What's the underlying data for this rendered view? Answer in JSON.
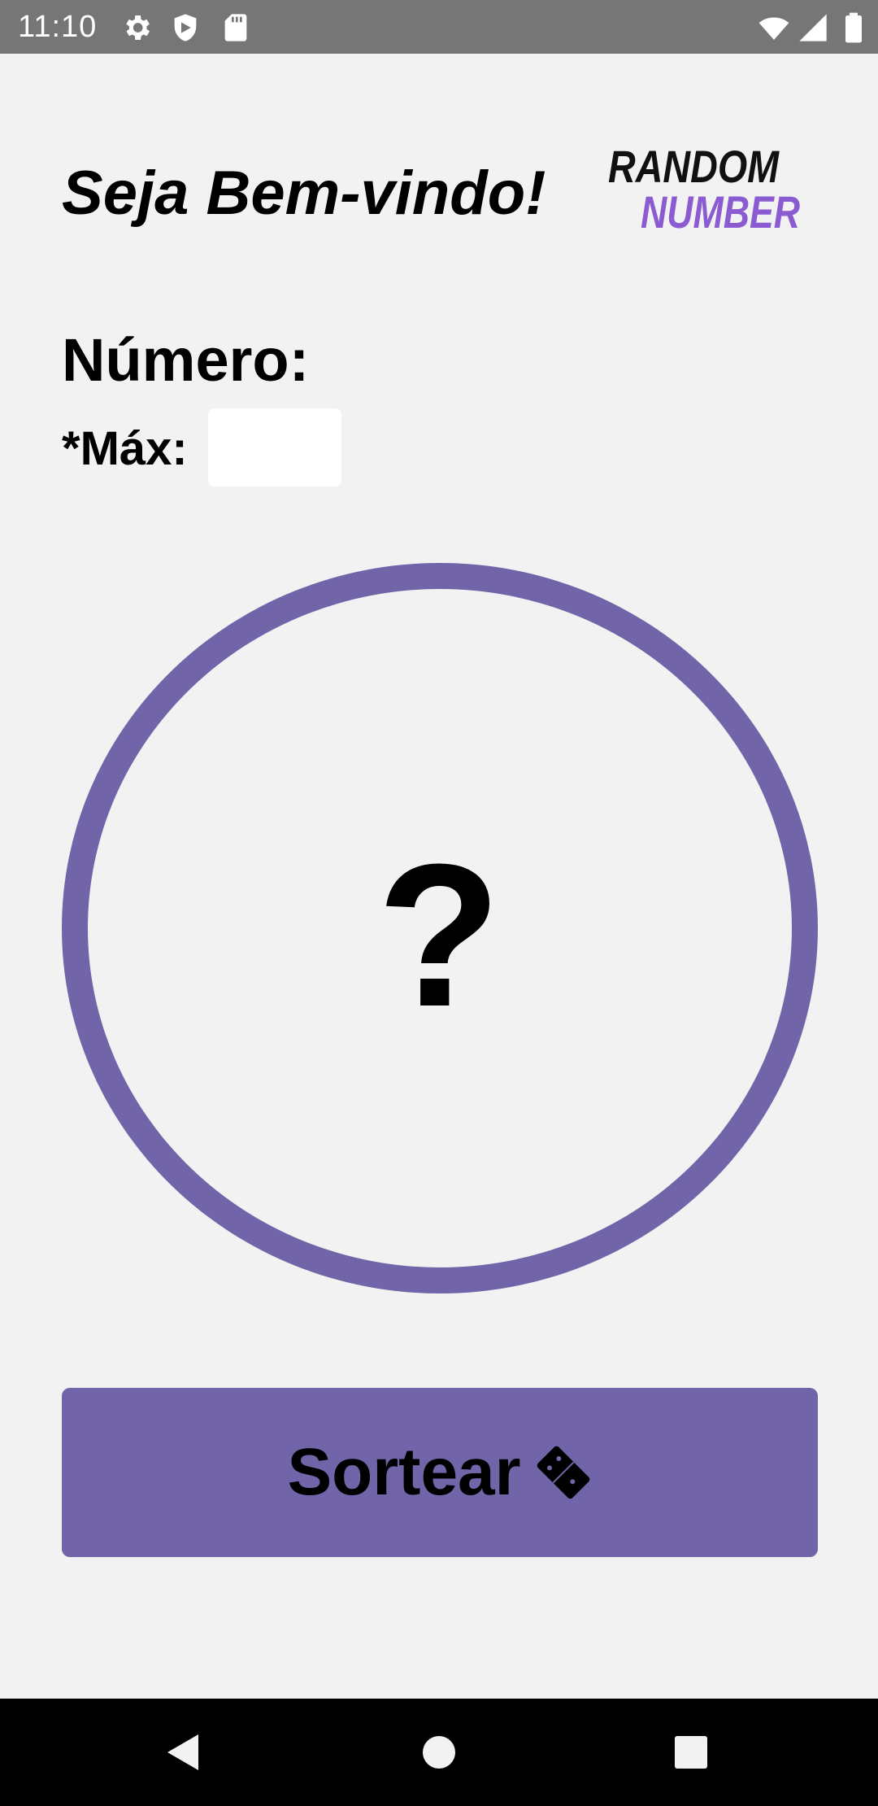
{
  "status_bar": {
    "time": "11:10",
    "icons": [
      "gear-icon",
      "shield-icon",
      "sd-card-icon",
      "wifi-icon",
      "signal-icon",
      "battery-icon"
    ]
  },
  "header": {
    "welcome": "Seja Bem-vindo!",
    "logo_line1": "RANDOM",
    "logo_line2": "NUMBER"
  },
  "form": {
    "number_label": "Número:",
    "max_label": "*Máx:",
    "max_value": ""
  },
  "result": {
    "value": "?"
  },
  "action": {
    "draw_label": "Sortear",
    "icon": "dice-icon"
  },
  "nav": {
    "buttons": [
      "back-icon",
      "home-icon",
      "recents-icon"
    ]
  },
  "colors": {
    "accent": "#7264a9",
    "background": "#f2f2f2",
    "status_bar": "#767676",
    "nav_bar": "#000000",
    "logo_accent": "#8a5bd1"
  }
}
